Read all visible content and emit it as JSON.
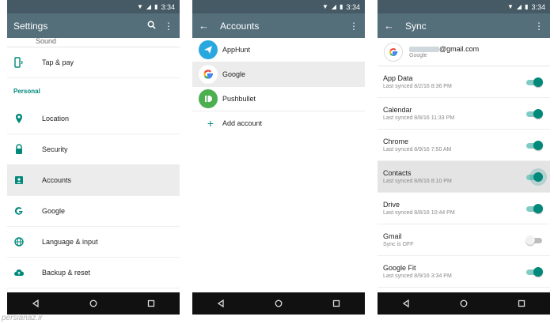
{
  "status": {
    "time": "3:34"
  },
  "colors": {
    "statusbar": "#455a64",
    "appbar": "#546e7a",
    "accent": "#00897b"
  },
  "settings": {
    "title": "Settings",
    "top_partial": "Sound",
    "items_top": [
      {
        "label": "Tap & pay",
        "icon": "tap-pay-icon"
      }
    ],
    "section_header": "Personal",
    "items": [
      {
        "label": "Location",
        "icon": "location-icon"
      },
      {
        "label": "Security",
        "icon": "lock-icon"
      },
      {
        "label": "Accounts",
        "icon": "accounts-icon"
      },
      {
        "label": "Google",
        "icon": "google-icon"
      },
      {
        "label": "Language & input",
        "icon": "globe-icon"
      },
      {
        "label": "Backup & reset",
        "icon": "cloud-upload-icon"
      }
    ]
  },
  "accounts": {
    "title": "Accounts",
    "items": [
      {
        "label": "AppHunt",
        "icon": "apphunt-icon"
      },
      {
        "label": "Google",
        "icon": "google-icon"
      },
      {
        "label": "Pushbullet",
        "icon": "pushbullet-icon"
      }
    ],
    "add_label": "Add account"
  },
  "sync": {
    "title": "Sync",
    "account_email_suffix": "@gmail.com",
    "account_type": "Google",
    "items": [
      {
        "name": "App Data",
        "meta": "Last synced 8/2/16 8:36 PM",
        "on": true
      },
      {
        "name": "Calendar",
        "meta": "Last synced 8/8/16 11:33 PM",
        "on": true
      },
      {
        "name": "Chrome",
        "meta": "Last synced 8/9/16 7:50 AM",
        "on": true
      },
      {
        "name": "Contacts",
        "meta": "Last synced 8/8/16 8:10 PM",
        "on": true
      },
      {
        "name": "Drive",
        "meta": "Last synced 8/8/16 10:44 PM",
        "on": true
      },
      {
        "name": "Gmail",
        "meta": "Sync is OFF",
        "on": false
      },
      {
        "name": "Google Fit",
        "meta": "Last synced 8/9/16 3:34 PM",
        "on": true
      }
    ]
  },
  "watermark": "persianaz.ir"
}
